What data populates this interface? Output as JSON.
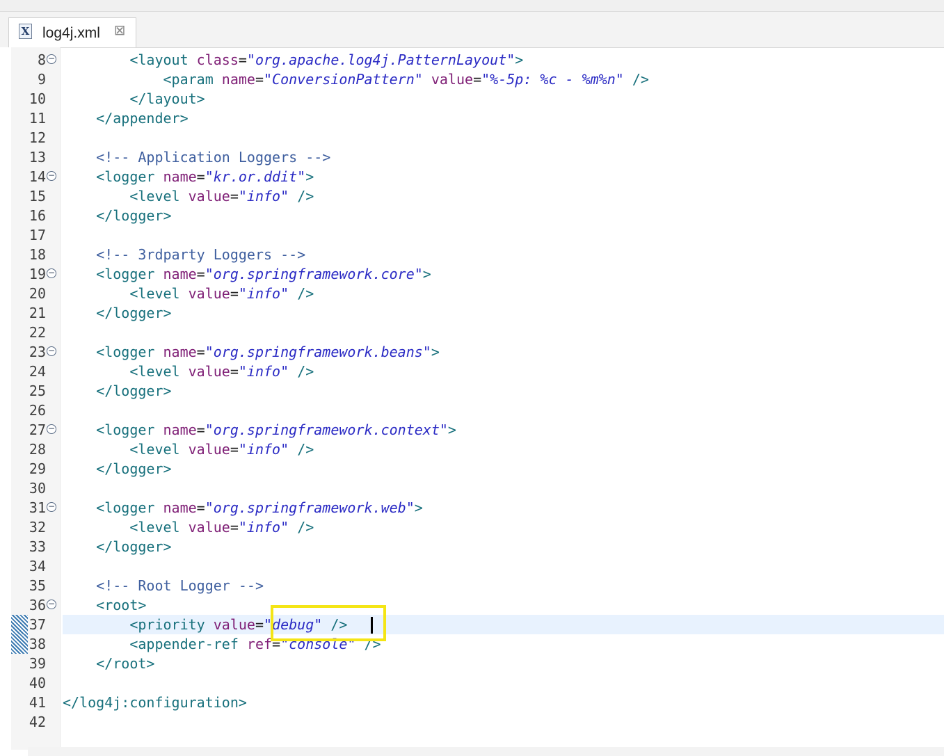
{
  "tab": {
    "icon": "X",
    "label": "log4j.xml",
    "close_glyph": "⊠"
  },
  "lines": [
    {
      "n": "8",
      "fold": true,
      "indent": "        ",
      "tokens": [
        {
          "t": "<layout ",
          "c": "tag"
        },
        {
          "t": "class",
          "c": "attr"
        },
        {
          "t": "=",
          "c": "plain"
        },
        {
          "t": "\"org.apache.log4j.PatternLayout\"",
          "c": "str"
        },
        {
          "t": ">",
          "c": "tag"
        }
      ]
    },
    {
      "n": "9",
      "indent": "            ",
      "tokens": [
        {
          "t": "<param ",
          "c": "tag"
        },
        {
          "t": "name",
          "c": "attr"
        },
        {
          "t": "=",
          "c": "plain"
        },
        {
          "t": "\"ConversionPattern\" ",
          "c": "str"
        },
        {
          "t": "value",
          "c": "attr"
        },
        {
          "t": "=",
          "c": "plain"
        },
        {
          "t": "\"%-5p: %c - %m%n\" ",
          "c": "str"
        },
        {
          "t": "/>",
          "c": "tag"
        }
      ]
    },
    {
      "n": "10",
      "indent": "        ",
      "tokens": [
        {
          "t": "</layout>",
          "c": "tag"
        }
      ]
    },
    {
      "n": "11",
      "indent": "    ",
      "tokens": [
        {
          "t": "</appender>",
          "c": "tag"
        }
      ]
    },
    {
      "n": "12",
      "indent": "",
      "tokens": []
    },
    {
      "n": "13",
      "indent": "    ",
      "tokens": [
        {
          "t": "<!-- Application Loggers -->",
          "c": "comment"
        }
      ]
    },
    {
      "n": "14",
      "fold": true,
      "indent": "    ",
      "tokens": [
        {
          "t": "<logger ",
          "c": "tag"
        },
        {
          "t": "name",
          "c": "attr"
        },
        {
          "t": "=",
          "c": "plain"
        },
        {
          "t": "\"kr.or.ddit\"",
          "c": "str"
        },
        {
          "t": ">",
          "c": "tag"
        }
      ]
    },
    {
      "n": "15",
      "indent": "        ",
      "tokens": [
        {
          "t": "<level ",
          "c": "tag"
        },
        {
          "t": "value",
          "c": "attr"
        },
        {
          "t": "=",
          "c": "plain"
        },
        {
          "t": "\"info\" ",
          "c": "str"
        },
        {
          "t": "/>",
          "c": "tag"
        }
      ]
    },
    {
      "n": "16",
      "indent": "    ",
      "tokens": [
        {
          "t": "</logger>",
          "c": "tag"
        }
      ]
    },
    {
      "n": "17",
      "indent": "",
      "tokens": []
    },
    {
      "n": "18",
      "indent": "    ",
      "tokens": [
        {
          "t": "<!-- 3rdparty Loggers -->",
          "c": "comment"
        }
      ]
    },
    {
      "n": "19",
      "fold": true,
      "indent": "    ",
      "tokens": [
        {
          "t": "<logger ",
          "c": "tag"
        },
        {
          "t": "name",
          "c": "attr"
        },
        {
          "t": "=",
          "c": "plain"
        },
        {
          "t": "\"org.springframework.core\"",
          "c": "str"
        },
        {
          "t": ">",
          "c": "tag"
        }
      ]
    },
    {
      "n": "20",
      "indent": "        ",
      "tokens": [
        {
          "t": "<level ",
          "c": "tag"
        },
        {
          "t": "value",
          "c": "attr"
        },
        {
          "t": "=",
          "c": "plain"
        },
        {
          "t": "\"info\" ",
          "c": "str"
        },
        {
          "t": "/>",
          "c": "tag"
        }
      ]
    },
    {
      "n": "21",
      "indent": "    ",
      "tokens": [
        {
          "t": "</logger>",
          "c": "tag"
        }
      ]
    },
    {
      "n": "22",
      "indent": "",
      "tokens": []
    },
    {
      "n": "23",
      "fold": true,
      "indent": "    ",
      "tokens": [
        {
          "t": "<logger ",
          "c": "tag"
        },
        {
          "t": "name",
          "c": "attr"
        },
        {
          "t": "=",
          "c": "plain"
        },
        {
          "t": "\"org.springframework.beans\"",
          "c": "str"
        },
        {
          "t": ">",
          "c": "tag"
        }
      ]
    },
    {
      "n": "24",
      "indent": "        ",
      "tokens": [
        {
          "t": "<level ",
          "c": "tag"
        },
        {
          "t": "value",
          "c": "attr"
        },
        {
          "t": "=",
          "c": "plain"
        },
        {
          "t": "\"info\" ",
          "c": "str"
        },
        {
          "t": "/>",
          "c": "tag"
        }
      ]
    },
    {
      "n": "25",
      "indent": "    ",
      "tokens": [
        {
          "t": "</logger>",
          "c": "tag"
        }
      ]
    },
    {
      "n": "26",
      "indent": "",
      "tokens": []
    },
    {
      "n": "27",
      "fold": true,
      "indent": "    ",
      "tokens": [
        {
          "t": "<logger ",
          "c": "tag"
        },
        {
          "t": "name",
          "c": "attr"
        },
        {
          "t": "=",
          "c": "plain"
        },
        {
          "t": "\"org.springframework.context\"",
          "c": "str"
        },
        {
          "t": ">",
          "c": "tag"
        }
      ]
    },
    {
      "n": "28",
      "indent": "        ",
      "tokens": [
        {
          "t": "<level ",
          "c": "tag"
        },
        {
          "t": "value",
          "c": "attr"
        },
        {
          "t": "=",
          "c": "plain"
        },
        {
          "t": "\"info\" ",
          "c": "str"
        },
        {
          "t": "/>",
          "c": "tag"
        }
      ]
    },
    {
      "n": "29",
      "indent": "    ",
      "tokens": [
        {
          "t": "</logger>",
          "c": "tag"
        }
      ]
    },
    {
      "n": "30",
      "indent": "",
      "tokens": []
    },
    {
      "n": "31",
      "fold": true,
      "indent": "    ",
      "tokens": [
        {
          "t": "<logger ",
          "c": "tag"
        },
        {
          "t": "name",
          "c": "attr"
        },
        {
          "t": "=",
          "c": "plain"
        },
        {
          "t": "\"org.springframework.web\"",
          "c": "str"
        },
        {
          "t": ">",
          "c": "tag"
        }
      ]
    },
    {
      "n": "32",
      "indent": "        ",
      "tokens": [
        {
          "t": "<level ",
          "c": "tag"
        },
        {
          "t": "value",
          "c": "attr"
        },
        {
          "t": "=",
          "c": "plain"
        },
        {
          "t": "\"info\" ",
          "c": "str"
        },
        {
          "t": "/>",
          "c": "tag"
        }
      ]
    },
    {
      "n": "33",
      "indent": "    ",
      "tokens": [
        {
          "t": "</logger>",
          "c": "tag"
        }
      ]
    },
    {
      "n": "34",
      "indent": "",
      "tokens": []
    },
    {
      "n": "35",
      "indent": "    ",
      "tokens": [
        {
          "t": "<!-- Root Logger -->",
          "c": "comment"
        }
      ]
    },
    {
      "n": "36",
      "fold": true,
      "indent": "    ",
      "tokens": [
        {
          "t": "<root>",
          "c": "tag"
        }
      ]
    },
    {
      "n": "37",
      "current": true,
      "marker": true,
      "indent": "        ",
      "tokens": [
        {
          "t": "<priority ",
          "c": "tag"
        },
        {
          "t": "value",
          "c": "attr"
        },
        {
          "t": "=",
          "c": "plain"
        },
        {
          "t": "\"debug\" ",
          "c": "str"
        },
        {
          "t": "/>",
          "c": "tag"
        }
      ]
    },
    {
      "n": "38",
      "marker": true,
      "indent": "        ",
      "tokens": [
        {
          "t": "<appender-ref ",
          "c": "tag"
        },
        {
          "t": "ref",
          "c": "attr"
        },
        {
          "t": "=",
          "c": "plain"
        },
        {
          "t": "\"console\" ",
          "c": "str"
        },
        {
          "t": "/>",
          "c": "tag"
        }
      ]
    },
    {
      "n": "39",
      "indent": "    ",
      "tokens": [
        {
          "t": "</root>",
          "c": "tag"
        }
      ]
    },
    {
      "n": "40",
      "indent": "",
      "tokens": []
    },
    {
      "n": "41",
      "indent": "",
      "tokens": [
        {
          "t": "</log4j:configuration>",
          "c": "tag"
        }
      ]
    },
    {
      "n": "42",
      "indent": "",
      "tokens": []
    }
  ]
}
